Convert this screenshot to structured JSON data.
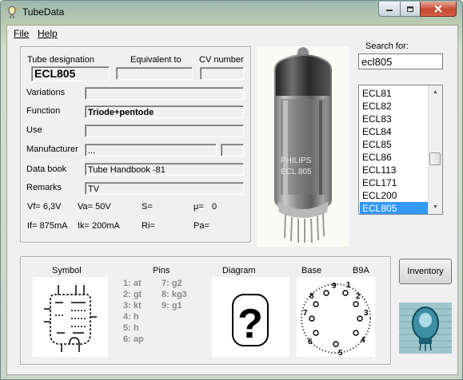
{
  "window": {
    "title": "TubeData"
  },
  "menu": {
    "file": "File",
    "help": "Help"
  },
  "tube": {
    "designation_label": "Tube designation",
    "equivalent_label": "Equivalent to",
    "cv_label": "CV number",
    "designation": "ECL805",
    "equivalent": "",
    "cv": "",
    "variations_label": "Variations",
    "variations": "",
    "function_label": "Function",
    "function": "Triode+pentode",
    "use_label": "Use",
    "use": "",
    "manufacturer_label": "Manufacturer",
    "manufacturer": "...",
    "manufacturer_extra": "",
    "databook_label": "Data book",
    "databook": "Tube Handbook -81",
    "remarks_label": "Remarks",
    "remarks": "TV"
  },
  "specs": {
    "vf": "Vf= 6,3V",
    "va": "Va=  50V",
    "s": "S=",
    "mu_label": "μ=",
    "mu": "0",
    "if": "If= 875mA",
    "ik": "Ik=   200mA",
    "ri": "Ri=",
    "pa": "Pa="
  },
  "search": {
    "label": "Search for:",
    "value": "ecl805",
    "items": [
      "ECL81",
      "ECL82",
      "ECL83",
      "ECL84",
      "ECL85",
      "ECL86",
      "ECL113",
      "ECL171",
      "ECL200",
      "ECL805"
    ],
    "selected": "ECL805"
  },
  "bottom": {
    "symbol_label": "Symbol",
    "pins_label": "Pins",
    "diagram_label": "Diagram",
    "base_label": "Base",
    "base_type": "B9A",
    "pins_col1": [
      "1: at",
      "2: gt",
      "3: kt",
      "4: h",
      "5: h",
      "6: ap"
    ],
    "pins_col2": [
      "7: g2",
      "8: kg3",
      "9: g1"
    ],
    "diagram_placeholder": "?",
    "base_numbers": [
      "9",
      "1",
      "2",
      "3",
      "4",
      "5",
      "6",
      "7",
      "8"
    ]
  },
  "buttons": {
    "inventory": "Inventory"
  },
  "photo_print": "PHILIPS ECL 805",
  "colors": {
    "selection": "#3399ff",
    "close_button": "#c6472f",
    "background": "#f0f0f0"
  }
}
